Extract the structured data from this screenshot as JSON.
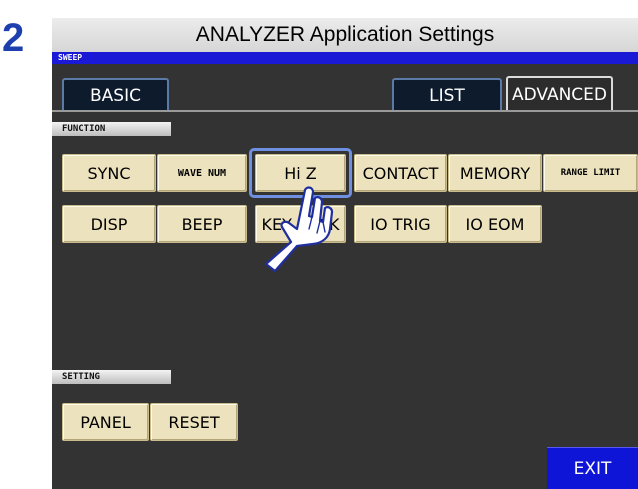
{
  "step_number": "2",
  "title": "ANALYZER Application Settings",
  "mode_label": "SWEEP",
  "tabs": {
    "basic": "BASIC",
    "list": "LIST",
    "advanced": "ADVANCED"
  },
  "function_section": {
    "label": "FUNCTION",
    "buttons": {
      "sync": "SYNC",
      "wave_num": "WAVE NUM",
      "hi_z": "Hi Z",
      "contact": "CONTACT",
      "memory": "MEMORY",
      "range_limit": "RANGE LIMIT",
      "disp": "DISP",
      "beep": "BEEP",
      "key_lock": "KEY LOCK",
      "io_trig": "IO TRIG",
      "io_eom": "IO EOM"
    }
  },
  "setting_section": {
    "label": "SETTING",
    "buttons": {
      "panel": "PANEL",
      "reset": "RESET"
    }
  },
  "exit_label": "EXIT",
  "colors": {
    "step_number": "#1e3fae",
    "screen_bg": "#333333",
    "mode_bar": "#1a1ad6",
    "button_face": "#ece2bd",
    "highlight_frame": "#6f8fe0",
    "exit_button": "#0e15d6"
  },
  "icons": {
    "pointer": "hand-pointer-icon"
  }
}
